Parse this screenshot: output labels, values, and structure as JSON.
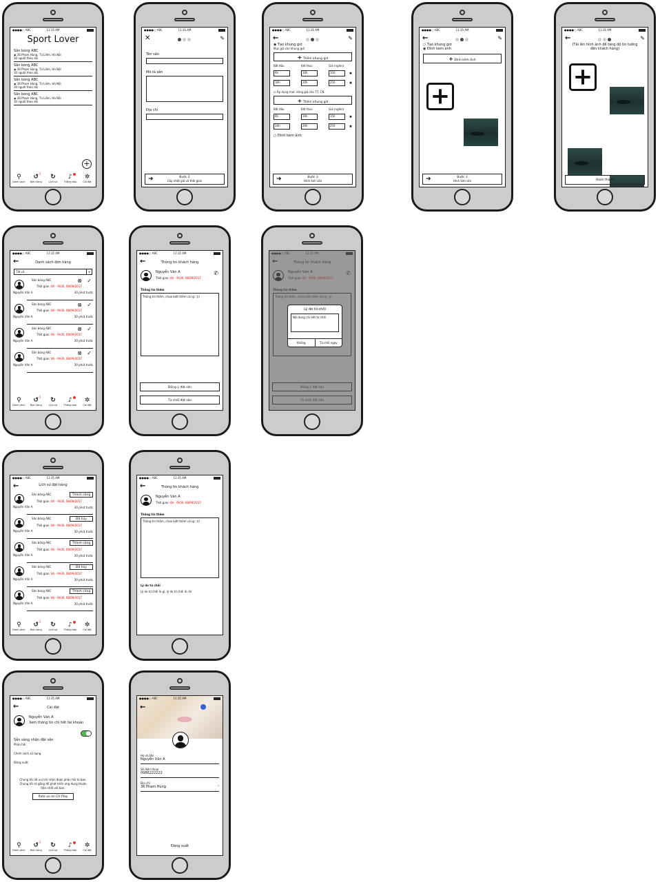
{
  "status": {
    "carrier": "●●●●○ ABC",
    "time": "11:35 AM"
  },
  "tabs": [
    "Danh sách",
    "Đơn hàng",
    "Lịch sử",
    "Thông báo",
    "Cài đặt"
  ],
  "tab_badge": "5",
  "icons": [
    "search-icon",
    "history-icon",
    "clock-icon",
    "bell-icon",
    "gear-icon",
    "back-arrow-icon",
    "pencil-icon",
    "close-icon",
    "plus-icon",
    "phone-icon",
    "check-icon",
    "cancel-icon",
    "chevron-right-icon",
    "avatar-icon"
  ],
  "s1": {
    "title": "Sport Lover",
    "items": [
      {
        "name": "Sân bóng ABC",
        "addr": "36 Phạm Hùng, Từ Liêm, Hà Nội",
        "follow": "30 người theo dõi"
      },
      {
        "name": "Sân bóng ABC",
        "addr": "36 Phạm Hùng, Từ Liêm, Hà Nội",
        "follow": "30 người theo dõi"
      },
      {
        "name": "Sân bóng ABC",
        "addr": "36 Phạm Hùng, Từ Liêm, Hà Nội",
        "follow": "30 người theo dõi"
      },
      {
        "name": "Sân bóng ABC",
        "addr": "36 Phạm Hùng, Từ Liêm, Hà Nội",
        "follow": "30 người theo dõi"
      }
    ]
  },
  "s2": {
    "name_label": "Tên sân",
    "desc_label": "Mô tả sân",
    "addr_label": "Địa chỉ",
    "next": "Bước 2",
    "next_sub": "Cập nhật giá và thời gian"
  },
  "s3": {
    "opt1": "Tạo khung giờ",
    "sub": "Mục giá các khung giờ",
    "add": "Thêm khung giờ",
    "cols": [
      "Bắt đầu",
      "Kết thúc",
      "Giá (nghìn)"
    ],
    "rows": [
      [
        "6h",
        "16h",
        "150"
      ],
      [
        "16h",
        "20h",
        "250"
      ]
    ],
    "weekend": "Áp dụng mức riêng giá cho T7, CN",
    "rows2": [
      [
        "6h",
        "16h",
        "150"
      ],
      [
        "16h",
        "20h",
        "250"
      ]
    ],
    "opt2": "Đính kèm ảnh",
    "next": "Bước 3",
    "next_sub": "Hình ảnh sân"
  },
  "s4": {
    "opt1": "Tạo khung giờ",
    "opt2": "Đính kèm ảnh",
    "attach": "Đính kèm ảnh",
    "next": "Bước 3",
    "next_sub": "Hình ảnh sân"
  },
  "s5": {
    "hint": "(Tải lên hình ảnh để tăng độ tin tưởng đến khách hàng)",
    "done": "Hoàn thành"
  },
  "s6": {
    "title": "Danh sách đơn hàng",
    "filter": "Tất cả",
    "orders": [
      {
        "name": "Sân bóng ABC",
        "time_label": "Thời gian:",
        "time": "8h - 9h30, 08/09/2017",
        "user": "Nguyễn Văn A",
        "ago": "30 phút trước"
      },
      {
        "name": "Sân bóng ABC",
        "time_label": "Thời gian:",
        "time": "8h - 9h30, 08/09/2017",
        "user": "Nguyễn Văn A",
        "ago": "30 phút trước"
      },
      {
        "name": "Sân bóng ABC",
        "time_label": "Thời gian:",
        "time": "8h - 9h30, 08/09/2017",
        "user": "Nguyễn Văn A",
        "ago": "30 phút trước"
      },
      {
        "name": "Sân bóng ABC",
        "time_label": "Thời gian:",
        "time": "8h - 9h30, 08/09/2017",
        "user": "Nguyễn Văn A",
        "ago": "30 phút trước"
      }
    ]
  },
  "s7": {
    "title": "Thông tin khách hàng",
    "user": "Nguyễn Văn A",
    "time_label": "Thời gian:",
    "time": "8h - 9h30, 08/09/2017",
    "info_label": "Thông tin thêm",
    "info": "Thông tin thêm, chưa biết thêm cái gì :)))",
    "accept": "Đồng ý đặt sân",
    "reject": "Từ chối đặt sân"
  },
  "s8": {
    "dialog_title": "Lý do từ chối",
    "dialog_placeholder": "Nội dung chi tiết từ chối",
    "no": "Không",
    "confirm": "Từ chối ngay"
  },
  "s9": {
    "title": "Lịch sử đặt hàng",
    "orders": [
      {
        "name": "Sân bóng ABC",
        "status": "Thành công",
        "time_label": "Thời gian:",
        "time": "8h - 9h30, 08/09/2017",
        "user": "Nguyễn Văn A",
        "ago": "30 phút trước"
      },
      {
        "name": "Sân bóng ABC",
        "status": "Đã hủy",
        "time_label": "Thời gian:",
        "time": "8h - 9h30, 08/09/2017",
        "user": "Nguyễn Văn A",
        "ago": "30 phút trước"
      },
      {
        "name": "Sân bóng ABC",
        "status": "Thành công",
        "time_label": "Thời gian:",
        "time": "8h - 9h30, 08/09/2017",
        "user": "Nguyễn Văn A",
        "ago": "30 phút trước"
      },
      {
        "name": "Sân bóng ABC",
        "status": "Đã hủy",
        "time_label": "Thời gian:",
        "time": "8h - 9h30, 08/09/2017",
        "user": "Nguyễn Văn A",
        "ago": "30 phút trước"
      },
      {
        "name": "Sân bóng ABC",
        "status": "Thành công",
        "time_label": "Thời gian:",
        "time": "8h - 9h30, 08/09/2017",
        "user": "Nguyễn Văn A",
        "ago": "30 phút trước"
      }
    ]
  },
  "s10": {
    "reason_label": "Lý do từ chối",
    "reason": "Lý do từ chối là gì, lý do từ chối là chi"
  },
  "s11": {
    "title": "Cài đặt",
    "user": "Nguyễn Văn A",
    "user_sub": "Xem thông tin chi tiết tài khoản",
    "ready": "Sẵn sàng nhận đặt sân",
    "feedback": "Phản hồi",
    "policy": "Chính sách sử dụng",
    "logout": "Đăng xuất",
    "note": "Chúng tôi rất vui khi nhận được phản hồi từ bạn. Chúng tôi cố gắng để phát triển ứng dụng thuận tiện nhất với bạn.",
    "rate": "Rate us on CH Play"
  },
  "s12": {
    "name_label": "Họ và tên",
    "name": "Nguyễn Văn A",
    "phone_label": "Số điện thoại",
    "phone": "0986222222",
    "addr_label": "Địa chỉ",
    "addr": "36 Phạm Hùng",
    "logout": "Đăng xuất"
  }
}
